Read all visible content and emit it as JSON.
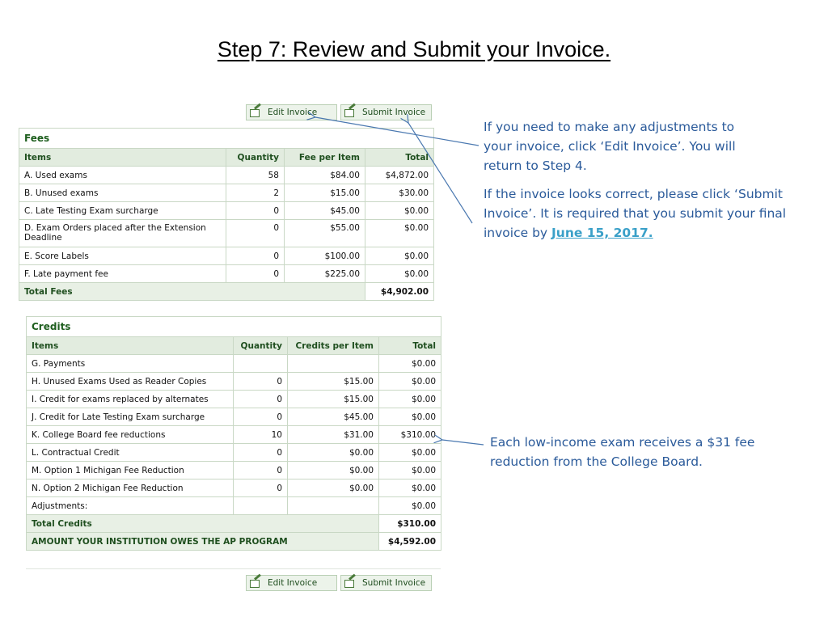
{
  "title": "Step 7: Review and Submit your Invoice.",
  "buttons": {
    "edit": "Edit Invoice",
    "submit": "Submit Invoice"
  },
  "fees": {
    "heading": "Fees",
    "headers": [
      "Items",
      "Quantity",
      "Fee per Item",
      "Total"
    ],
    "rows": [
      [
        "A. Used exams",
        "58",
        "$84.00",
        "$4,872.00"
      ],
      [
        "B. Unused exams",
        "2",
        "$15.00",
        "$30.00"
      ],
      [
        "C. Late Testing Exam surcharge",
        "0",
        "$45.00",
        "$0.00"
      ],
      [
        "D. Exam Orders placed after the Extension Deadline",
        "0",
        "$55.00",
        "$0.00"
      ],
      [
        "E. Score Labels",
        "0",
        "$100.00",
        "$0.00"
      ],
      [
        "F. Late payment fee",
        "0",
        "$225.00",
        "$0.00"
      ]
    ],
    "total_label": "Total Fees",
    "total_value": "$4,902.00"
  },
  "credits": {
    "heading": "Credits",
    "headers": [
      "Items",
      "Quantity",
      "Credits per Item",
      "Total"
    ],
    "rows": [
      [
        "G. Payments",
        "",
        "",
        "$0.00"
      ],
      [
        "H. Unused Exams Used as Reader Copies",
        "0",
        "$15.00",
        "$0.00"
      ],
      [
        "I. Credit for exams replaced by alternates",
        "0",
        "$15.00",
        "$0.00"
      ],
      [
        "J. Credit for Late Testing Exam surcharge",
        "0",
        "$45.00",
        "$0.00"
      ],
      [
        "K. College Board fee reductions",
        "10",
        "$31.00",
        "$310.00"
      ],
      [
        "L. Contractual Credit",
        "0",
        "$0.00",
        "$0.00"
      ],
      [
        "M. Option 1 Michigan Fee Reduction",
        "0",
        "$0.00",
        "$0.00"
      ],
      [
        "N. Option 2 Michigan Fee Reduction",
        "0",
        "$0.00",
        "$0.00"
      ],
      [
        "Adjustments:",
        "",
        "",
        "$0.00"
      ]
    ],
    "total_label": "Total Credits",
    "total_value": "$310.00",
    "owes_label": "AMOUNT YOUR INSTITUTION OWES THE AP PROGRAM",
    "owes_value": "$4,592.00"
  },
  "notes": {
    "edit_note": "If you need to make any adjustments to your invoice, click ‘Edit Invoice’.  You will return to Step 4.",
    "submit_note": "If the invoice looks correct, please click ‘Submit Invoice’.  It is required that you submit your final invoice by ",
    "deadline": "June 15, 2017.",
    "reduction_note": "Each low-income exam receives a $31 fee reduction from the College Board."
  },
  "colors": {
    "accent_green": "#1f5f1f",
    "note_blue": "#2a5a9a",
    "link_blue": "#3aa0c8"
  }
}
